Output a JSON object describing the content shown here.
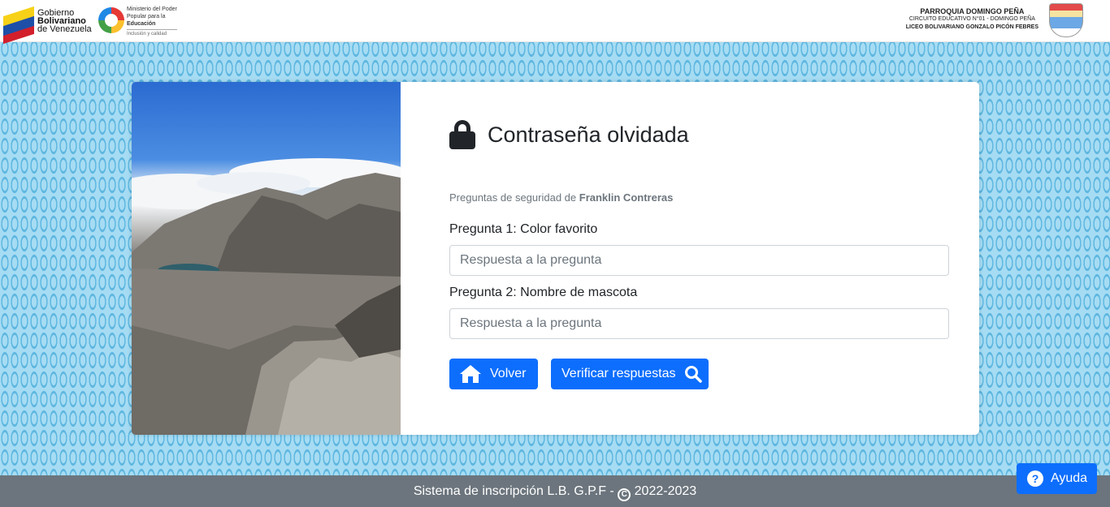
{
  "header": {
    "gov_line1": "Gobierno",
    "gov_line2": "Bolivariano",
    "gov_line3": "de Venezuela",
    "ministry_line1": "Ministerio del Poder",
    "ministry_line2": "Popular para la",
    "ministry_line3": "Educación",
    "ministry_slogan": "Inclusión y calidad",
    "school_line1": "PARROQUIA DOMINGO PEÑA",
    "school_line2": "CIRCUITO EDUCATIVO N°01 - DOMINGO PEÑA",
    "school_line3": "LICEO BOLIVARIANO GONZALO PICÓN FEBRES"
  },
  "form": {
    "title": "Contraseña olvidada",
    "security_prefix": "Preguntas de seguridad de",
    "user_name": "Franklin Contreras",
    "question1_label": "Pregunta 1: Color favorito",
    "question1_placeholder": "Respuesta a la pregunta",
    "question1_value": "",
    "question2_label": "Pregunta 2: Nombre de mascota",
    "question2_placeholder": "Respuesta a la pregunta",
    "question2_value": "",
    "back_label": "Volver",
    "verify_label": "Verificar respuestas",
    "icons": [
      "lock-icon",
      "home-icon",
      "search-icon"
    ]
  },
  "footer": {
    "text": "Sistema de inscripción L.B. G.P.F -",
    "copyright_symbol": "C",
    "years": "2022-2023"
  },
  "help": {
    "label": "Ayuda",
    "icon_glyph": "?"
  },
  "colors": {
    "primary": "#0d6efd",
    "footer_bg": "#6c757d",
    "page_bg": "#a6dcf3",
    "pattern": "#5fb7e0"
  }
}
